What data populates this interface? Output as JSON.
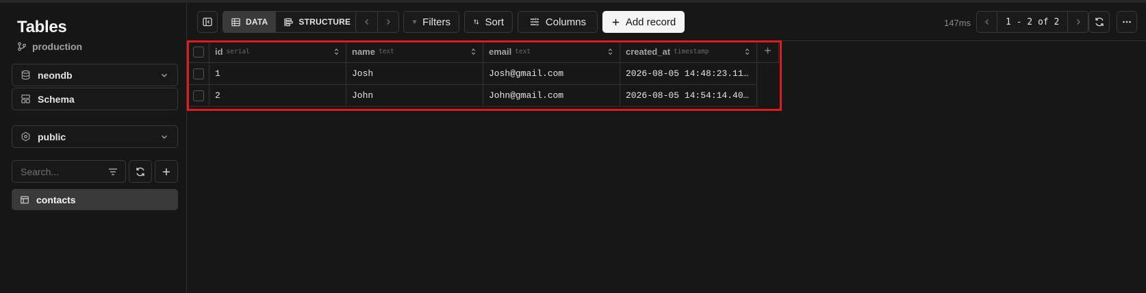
{
  "sidebar": {
    "title": "Tables",
    "branch": "production",
    "database": "neondb",
    "schema_link": "Schema",
    "schema_select": "public",
    "search_placeholder": "Search...",
    "tables": [
      {
        "name": "contacts",
        "selected": true
      }
    ]
  },
  "toolbar": {
    "view_data": "DATA",
    "view_structure": "STRUCTURE",
    "filters": "Filters",
    "sort": "Sort",
    "columns": "Columns",
    "add_record": "Add record",
    "timing": "147ms",
    "pagination": "1 - 2 of 2"
  },
  "table": {
    "columns": [
      {
        "name": "id",
        "type": "serial"
      },
      {
        "name": "name",
        "type": "text"
      },
      {
        "name": "email",
        "type": "text"
      },
      {
        "name": "created_at",
        "type": "timestamp"
      }
    ],
    "rows": [
      {
        "id": "1",
        "name": "Josh",
        "email": "Josh@gmail.com",
        "created_at": "2026-08-05 14:48:23.11…"
      },
      {
        "id": "2",
        "name": "John",
        "email": "John@gmail.com",
        "created_at": "2026-08-05 14:54:14.40…"
      }
    ],
    "add_column_label": "+"
  },
  "colors": {
    "background": "#171717",
    "highlight": "#e01b1b",
    "primary_button": "#f5f5f5"
  }
}
